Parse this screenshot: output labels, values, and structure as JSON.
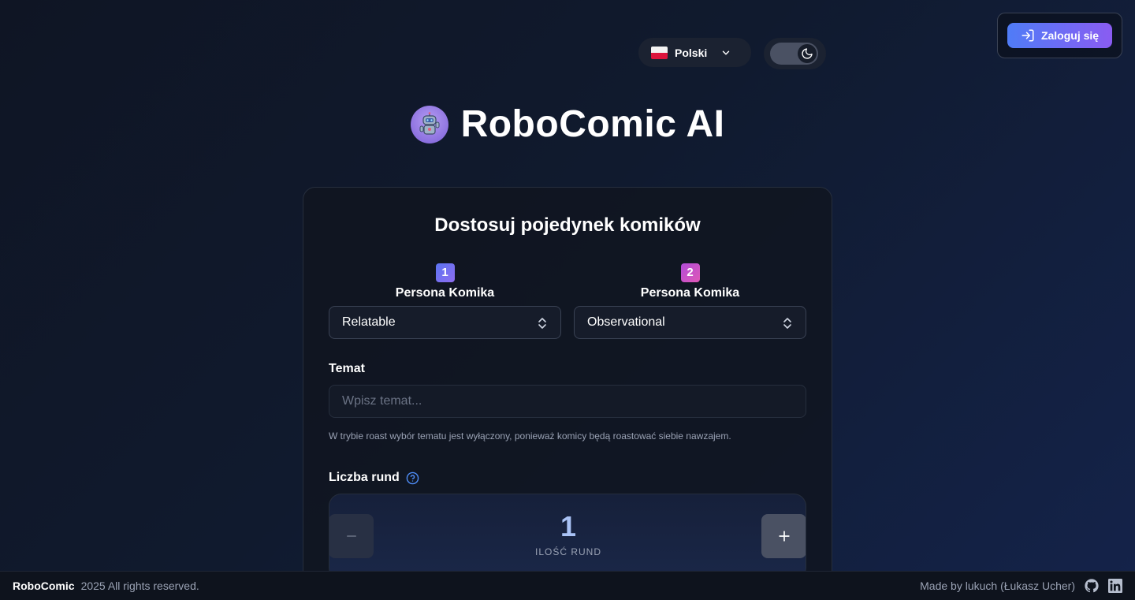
{
  "header": {
    "login_label": "Zaloguj się",
    "language": "Polski",
    "theme_mode": "dark"
  },
  "app": {
    "title": "RoboComic AI"
  },
  "card": {
    "heading": "Dostosuj pojedynek komików",
    "personas": [
      {
        "badge": "1",
        "label": "Persona Komika",
        "value": "Relatable"
      },
      {
        "badge": "2",
        "label": "Persona Komika",
        "value": "Observational"
      }
    ],
    "topic": {
      "label": "Temat",
      "placeholder": "Wpisz temat...",
      "value": "",
      "note": "W trybie roast wybór tematu jest wyłączony, ponieważ komicy będą roastować siebie nawzajem."
    },
    "rounds": {
      "label": "Liczba rund",
      "value": "1",
      "caption": "ILOŚĆ RUND"
    }
  },
  "footer": {
    "brand": "RoboComic",
    "copyright": "2025 All rights reserved.",
    "credit": "Made by lukuch (Łukasz Ucher)"
  },
  "colors": {
    "accent_gradient_start": "#4f7cf7",
    "accent_gradient_end": "#8a5cf2",
    "badge_1": "#6b6ff1",
    "badge_2": "#c850c8",
    "help_icon": "#4f8df7",
    "round_value": "#a9c2f5"
  },
  "icons": {
    "login": "login-arrow-icon",
    "language_flag": "poland-flag-icon",
    "language_chevron": "chevron-down-icon",
    "theme": "moon-icon",
    "logo": "robot-icon",
    "select": "chevron-up-down-icon",
    "help": "question-circle-icon",
    "decrement": "minus-icon",
    "increment": "plus-icon",
    "github": "github-icon",
    "linkedin": "linkedin-icon"
  }
}
